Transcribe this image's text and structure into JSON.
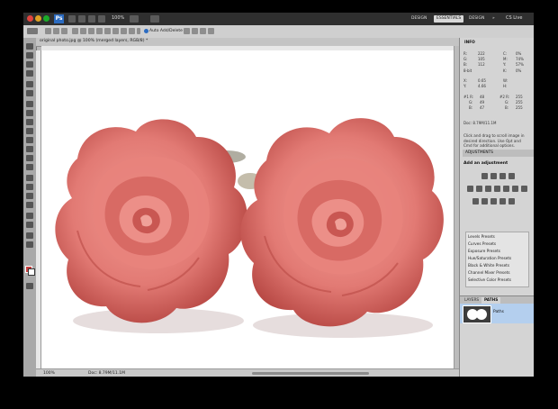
{
  "app": {
    "logo": "Ps",
    "zoom": "100%",
    "workspaces": [
      "DESIGN",
      "ESSENTIALS",
      "DESIGN"
    ],
    "active_workspace": "ESSENTIALS",
    "cs_live": "CS Live"
  },
  "options_bar": {
    "auto_add_delete": "Auto Add/Delete"
  },
  "document": {
    "tab_title": "original photo.jpg @ 100% (merged layers, RGB/8) *",
    "zoom": "100%",
    "doc_size": "Doc: 8.79M/11.1M"
  },
  "info_panel": {
    "tab": "INFO",
    "rows": [
      [
        "R:",
        "222",
        "G:",
        "C:",
        "0%"
      ],
      [
        "G:",
        "105",
        "",
        "M:",
        "74%"
      ],
      [
        "B:",
        "112",
        "",
        "Y:",
        "57%"
      ],
      [
        "8-bit",
        "",
        "",
        "K:",
        "0%"
      ],
      [
        "X:",
        "0.65",
        "",
        "W:",
        ""
      ],
      [
        "Y:",
        "4.66",
        "",
        "H:",
        ""
      ],
      [
        "#1 R:",
        "48",
        "",
        "#2 R:",
        "255"
      ],
      [
        "G:",
        "49",
        "",
        "G:",
        "255"
      ],
      [
        "B:",
        "47",
        "",
        "B:",
        "255"
      ]
    ],
    "doc_line": "Doc: 8.79M/11.1M",
    "hint": "Click and drag to scroll image in desired direction. Use Opt and Cmd for additional options."
  },
  "adjustments_panel": {
    "tab": "ADJUSTMENTS",
    "title": "Add an adjustment",
    "presets": [
      "Levels Presets",
      "Curves Presets",
      "Exposure Presets",
      "Hue/Saturation Presets",
      "Black & White Presets",
      "Channel Mixer Presets",
      "Selective Color Presets"
    ]
  },
  "layers_panel": {
    "tabs": [
      "LAYERS",
      "PATHS"
    ],
    "active_tab": "PATHS",
    "layer_name": "Paths"
  },
  "colors": {
    "foreground": "#c84040",
    "background": "#ffffff",
    "rose": "#e27a74",
    "rose_dark": "#b3433f"
  }
}
